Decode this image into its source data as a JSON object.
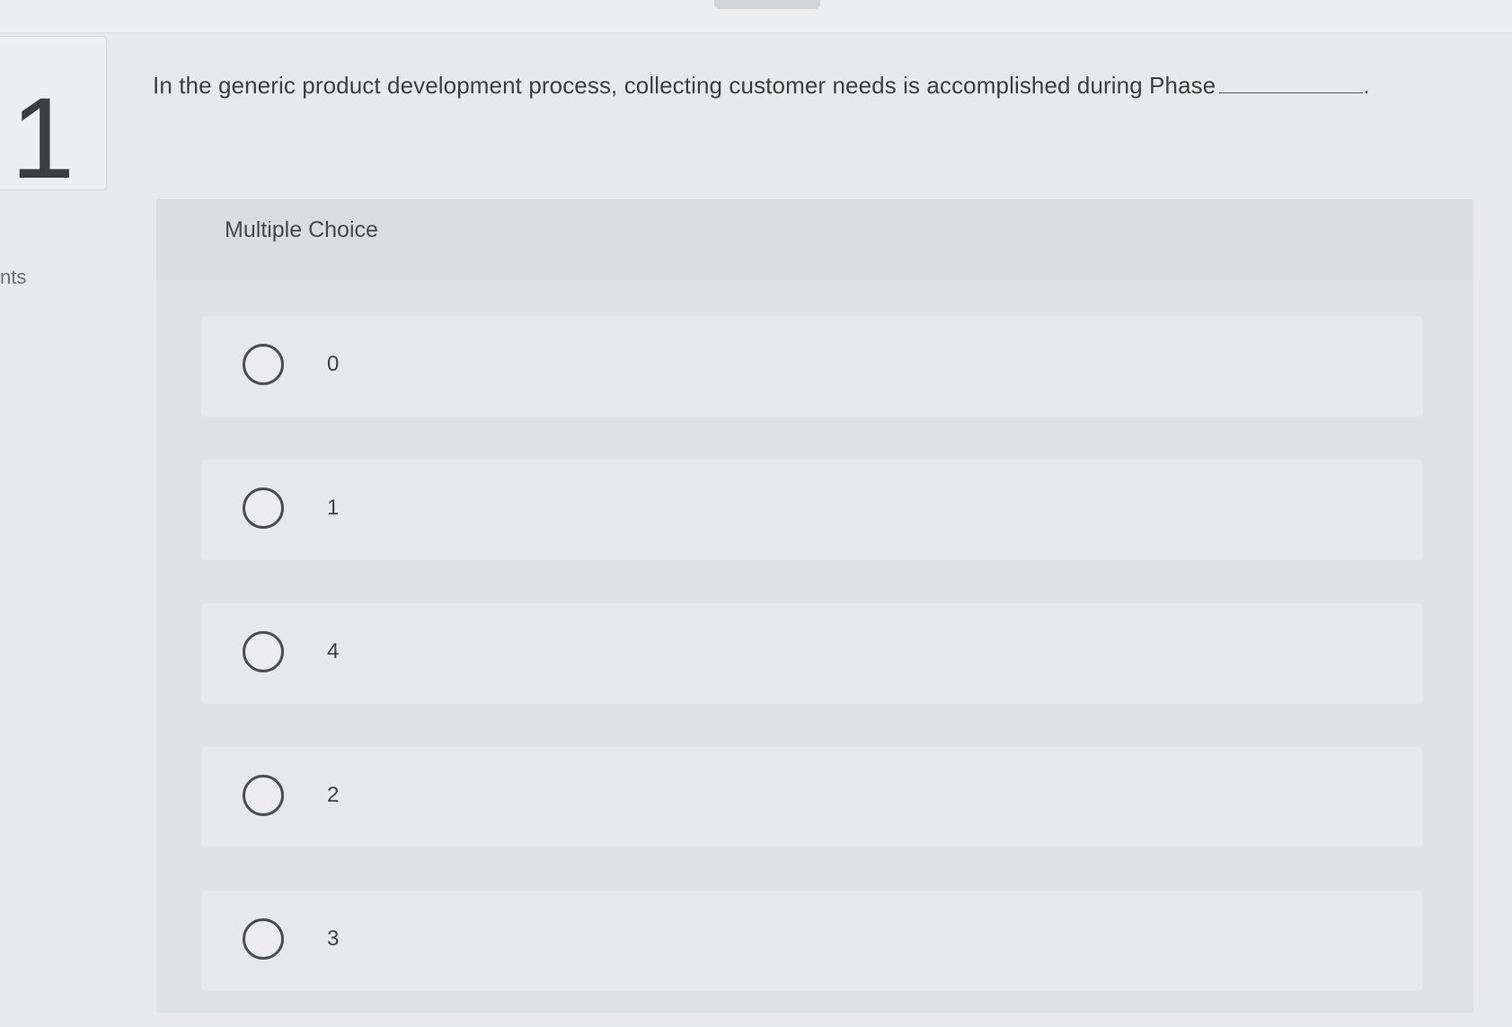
{
  "question": {
    "number": "1",
    "points_label": "nts",
    "text": "In the generic product development process, collecting customer needs is accomplished during Phase",
    "trailing_punctuation": "."
  },
  "multiple_choice": {
    "header": "Multiple Choice",
    "options": [
      {
        "label": "0"
      },
      {
        "label": "1"
      },
      {
        "label": "4"
      },
      {
        "label": "2"
      },
      {
        "label": "3"
      }
    ]
  }
}
